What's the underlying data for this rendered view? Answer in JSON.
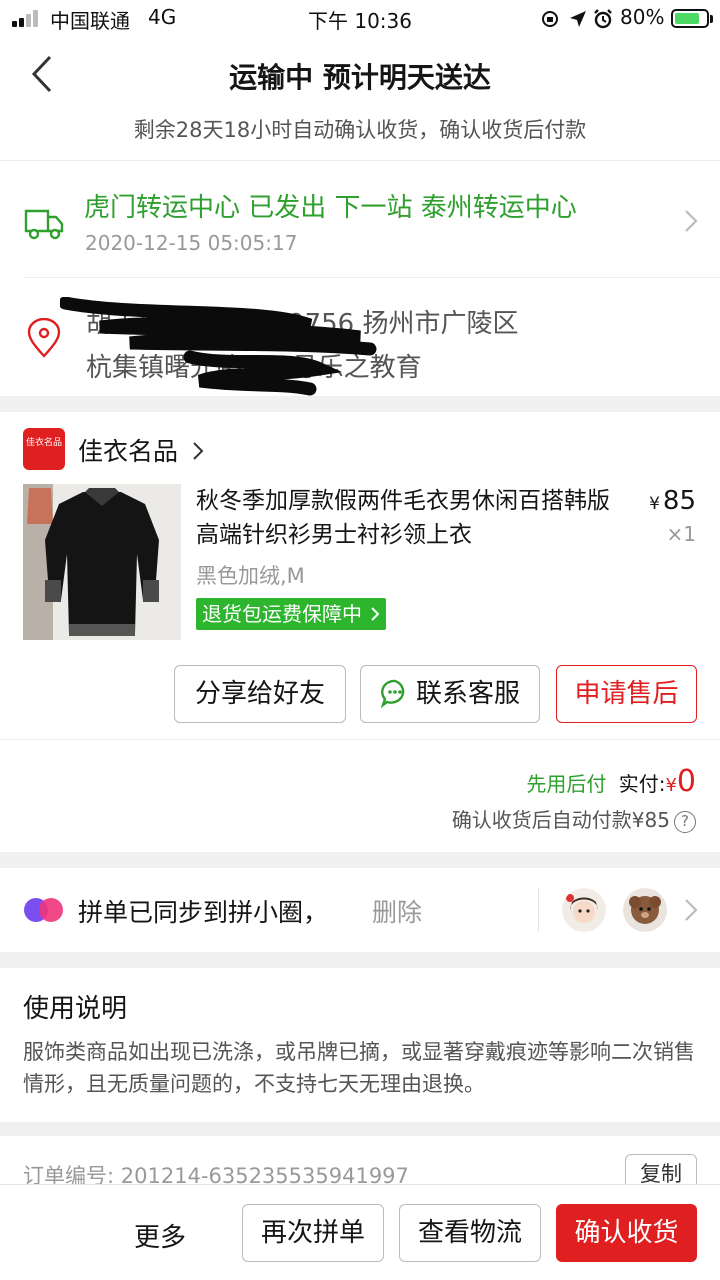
{
  "status_bar": {
    "carrier": "中国联通",
    "network": "4G",
    "time": "下午 10:36",
    "battery": "80%"
  },
  "header": {
    "title": "运输中 预计明天送达",
    "subtitle": "剩余28天18小时自动确认收货，确认收货后付款"
  },
  "logistics": {
    "status": "虎门转运中心 已发出 下一站 泰州转运中心",
    "time": "2020-12-15 05:05:17",
    "status_color": "#2fa02f"
  },
  "address": {
    "line1": "胡志厂 13095529756  扬州市广陵区",
    "line2": "杭集镇曙光路388号乐之教育"
  },
  "shop": {
    "logo_text": "佳衣名品",
    "name": "佳衣名品"
  },
  "goods": {
    "title": "秋冬季加厚款假两件毛衣男休闲百搭韩版高端针织衫男士衬衫领上衣",
    "price_symbol": "¥",
    "price": "85",
    "quantity": "×1",
    "sku": "黑色加绒,M",
    "tag": "退货包运费保障中"
  },
  "actions": {
    "share": "分享给好友",
    "contact": "联系客服",
    "after_sale": "申请售后"
  },
  "payment": {
    "pay_later": "先用后付",
    "paid_label": "实付:",
    "paid_symbol": "¥",
    "paid_value": "0",
    "auto_pay_note": "确认收货后自动付款¥85",
    "help": "?"
  },
  "circle": {
    "text": "拼单已同步到拼小圈，",
    "delete": "删除"
  },
  "instructions": {
    "title": "使用说明",
    "body": "服饰类商品如出现已洗涤，或吊牌已摘，或显著穿戴痕迹等影响二次销售情形，且无质量问题的，不支持七天无理由退换。"
  },
  "order": {
    "number_text": "订单编号:  201214-635235535941997",
    "copy": "复制"
  },
  "bottom": {
    "more": "更多",
    "reorder": "再次拼单",
    "track": "查看物流",
    "confirm": "确认收货"
  },
  "colors": {
    "accent_red": "#e02020",
    "accent_green": "#2fa02f"
  }
}
